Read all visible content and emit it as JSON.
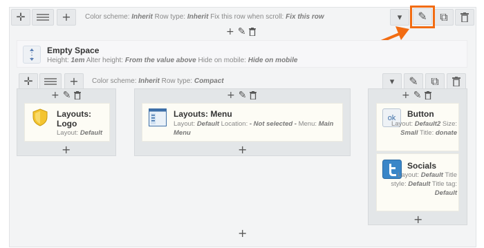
{
  "top_row": {
    "meta": {
      "color_label": "Color scheme:",
      "color_value": "Inherit",
      "rowtype_label": "Row type:",
      "rowtype_value": "Inherit",
      "fix_label": "Fix this row when scroll:",
      "fix_value": "Fix this row"
    },
    "icons": {
      "move": "+",
      "add": "+",
      "more": "▾",
      "edit": "✎",
      "copy": "⧉",
      "delete": "🗑"
    }
  },
  "empty_space": {
    "title": "Empty Space",
    "height_label": "Height:",
    "height_value": "1em",
    "alter_label": "Alter height:",
    "alter_value": "From the value above",
    "hide_label": "Hide on mobile:",
    "hide_value": "Hide on mobile"
  },
  "inner_row": {
    "meta": {
      "color_label": "Color scheme:",
      "color_value": "Inherit",
      "rowtype_label": "Row type:",
      "rowtype_value": "Compact"
    }
  },
  "columns": {
    "logo": {
      "title": "Layouts: Logo",
      "layout_label": "Layout:",
      "layout_value": "Default"
    },
    "menu": {
      "title": "Layouts: Menu",
      "layout_label": "Layout:",
      "layout_value": "Default",
      "location_label": "Location:",
      "location_value": "- Not selected -",
      "menu_label": "Menu:",
      "menu_value": "Main Menu"
    },
    "button": {
      "title": "Button",
      "layout_label": "Layout:",
      "layout_value": "Default2",
      "size_label": "Size:",
      "size_value": "Small",
      "title_label": "Title:",
      "title_value": "donate",
      "icon_text": "ok"
    },
    "socials": {
      "title": "Socials",
      "layout_label": "Layout:",
      "layout_value": "Default",
      "style_label": "Title style:",
      "style_value": "Default",
      "tag_label": "Title tag:",
      "tag_value": "Default"
    }
  },
  "colors": {
    "accent": "#f26c12"
  }
}
